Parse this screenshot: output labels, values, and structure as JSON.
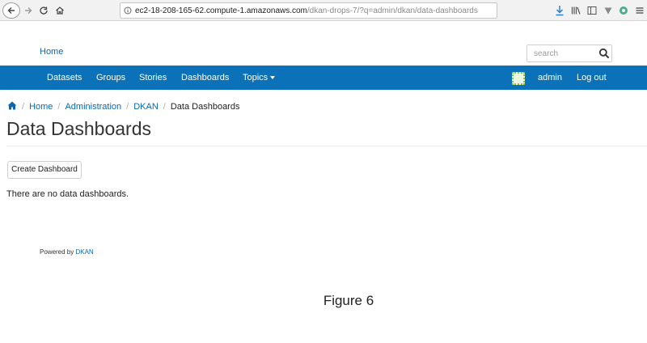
{
  "browser": {
    "url_host": "ec2-18-208-165-62.compute-1.amazonaws.com",
    "url_path": "/dkan-drops-7/?q=admin/dkan/data-dashboards",
    "icons": [
      "back-icon",
      "forward-icon",
      "reload-icon",
      "home-icon",
      "info-icon",
      "download-icon",
      "library-icon",
      "sidebar-icon",
      "shield-icon",
      "extension-icon",
      "menu-icon"
    ]
  },
  "header": {
    "home_link": "Home",
    "search": {
      "placeholder": "search",
      "value": ""
    }
  },
  "nav": {
    "items": [
      "Datasets",
      "Groups",
      "Stories",
      "Dashboards",
      "Topics"
    ],
    "user": "admin",
    "logout": "Log out",
    "bar_color": "#0b71b8"
  },
  "breadcrumb": {
    "items": [
      "Home",
      "Administration",
      "DKAN"
    ],
    "current": "Data Dashboards"
  },
  "page": {
    "title": "Data Dashboards",
    "create_button": "Create Dashboard",
    "empty_message": "There are no data dashboards."
  },
  "footer": {
    "powered_by": "Powered by",
    "powered_link": "DKAN"
  },
  "caption": "Figure 6",
  "colors": {
    "link": "#0b67b2",
    "accent": "#0b71b8"
  }
}
